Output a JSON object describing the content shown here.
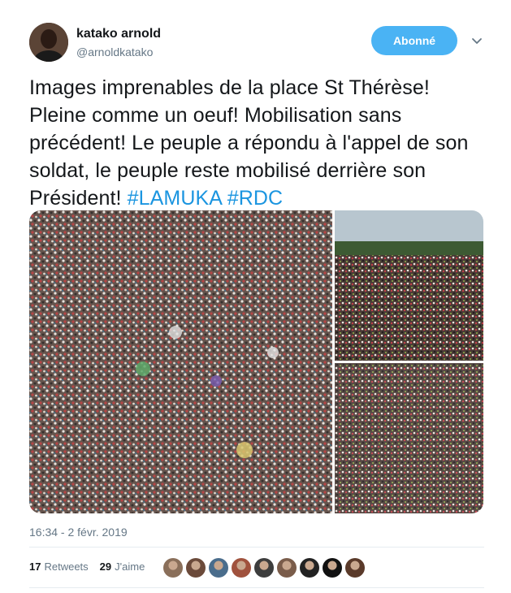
{
  "author": {
    "name": "katako arnold",
    "handle": "@arnoldkatako",
    "avatar_icon": "user-avatar-photo"
  },
  "follow_button": {
    "label": "Abonné"
  },
  "menu_icon": "chevron-down-icon",
  "tweet": {
    "text": "Images imprenables de la place St Thérèse! Pleine comme un oeuf! Mobilisation sans précédent! Le peuple a répondu à l'appel de son soldat, le peuple reste mobilisé derrière son Président!",
    "hashtags": [
      "#LAMUKA",
      "#RDC"
    ],
    "images": [
      "crowd-aerial-photo-1",
      "crowd-aerial-photo-2",
      "crowd-aerial-photo-3"
    ]
  },
  "timestamp": "16:34 - 2 févr. 2019",
  "stats": {
    "retweets_count": "17",
    "retweets_label": "Retweets",
    "likes_count": "29",
    "likes_label": "J'aime"
  },
  "likers": [
    "#8a6f5a",
    "#6b4a3a",
    "#4a6d8c",
    "#a0523d",
    "#3d3d3d",
    "#7a5c4a",
    "#222222",
    "#111111",
    "#5a3a2a"
  ],
  "colors": {
    "accent": "#1b95e0",
    "button": "#4ab3f4",
    "secondary_text": "#657786"
  }
}
